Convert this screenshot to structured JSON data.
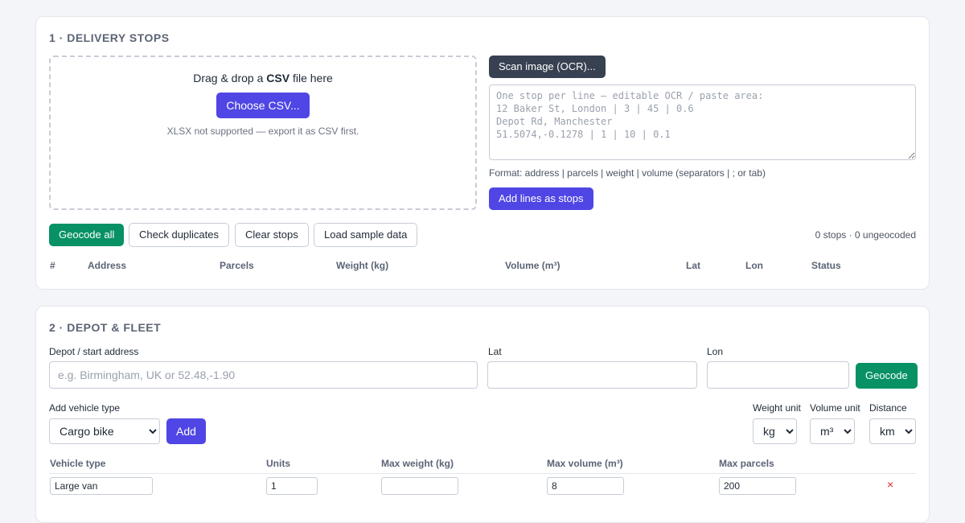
{
  "stops": {
    "title": "1 · DELIVERY STOPS",
    "drop_pre": "Drag & drop a ",
    "drop_bold": "CSV",
    "drop_post": " file here",
    "choose_label": "Choose CSV...",
    "xlsx_note": "XLSX not supported — export it as CSV first.",
    "scan_label": "Scan image (OCR)...",
    "ocr_placeholder": "One stop per line — editable OCR / paste area:\n12 Baker St, London | 3 | 45 | 0.6\nDepot Rd, Manchester\n51.5074,-0.1278 | 1 | 10 | 0.1",
    "format_note": "Format: address | parcels | weight | volume (separators | ; or tab)",
    "add_lines_label": "Add lines as stops",
    "geocode_all_label": "Geocode all",
    "check_dup_label": "Check duplicates",
    "clear_label": "Clear stops",
    "sample_label": "Load sample data",
    "stats": "0 stops · 0 ungeocoded",
    "columns": [
      "#",
      "Address",
      "Parcels",
      "Weight (kg)",
      "Volume (m³)",
      "Lat",
      "Lon",
      "Status"
    ]
  },
  "depot": {
    "title": "2 · DEPOT & FLEET",
    "address_label": "Depot / start address",
    "address_placeholder": "e.g. Birmingham, UK or 52.48,-1.90",
    "lat_label": "Lat",
    "lon_label": "Lon",
    "geocode_label": "Geocode",
    "vehicle_type_label": "Add vehicle type",
    "vehicle_selected": "Cargo bike",
    "add_label": "Add",
    "weight_unit_label": "Weight unit",
    "weight_unit": "kg",
    "volume_unit_label": "Volume unit",
    "volume_unit": "m³",
    "distance_label": "Distance",
    "distance_unit": "km",
    "columns": [
      "Vehicle type",
      "Units",
      "Max weight (kg)",
      "Max volume (m³)",
      "Max parcels"
    ],
    "rows": [
      {
        "type": "Large van",
        "units": "1",
        "max_weight": "",
        "max_volume": "8",
        "max_parcels": "200",
        "remove": "×"
      }
    ]
  }
}
